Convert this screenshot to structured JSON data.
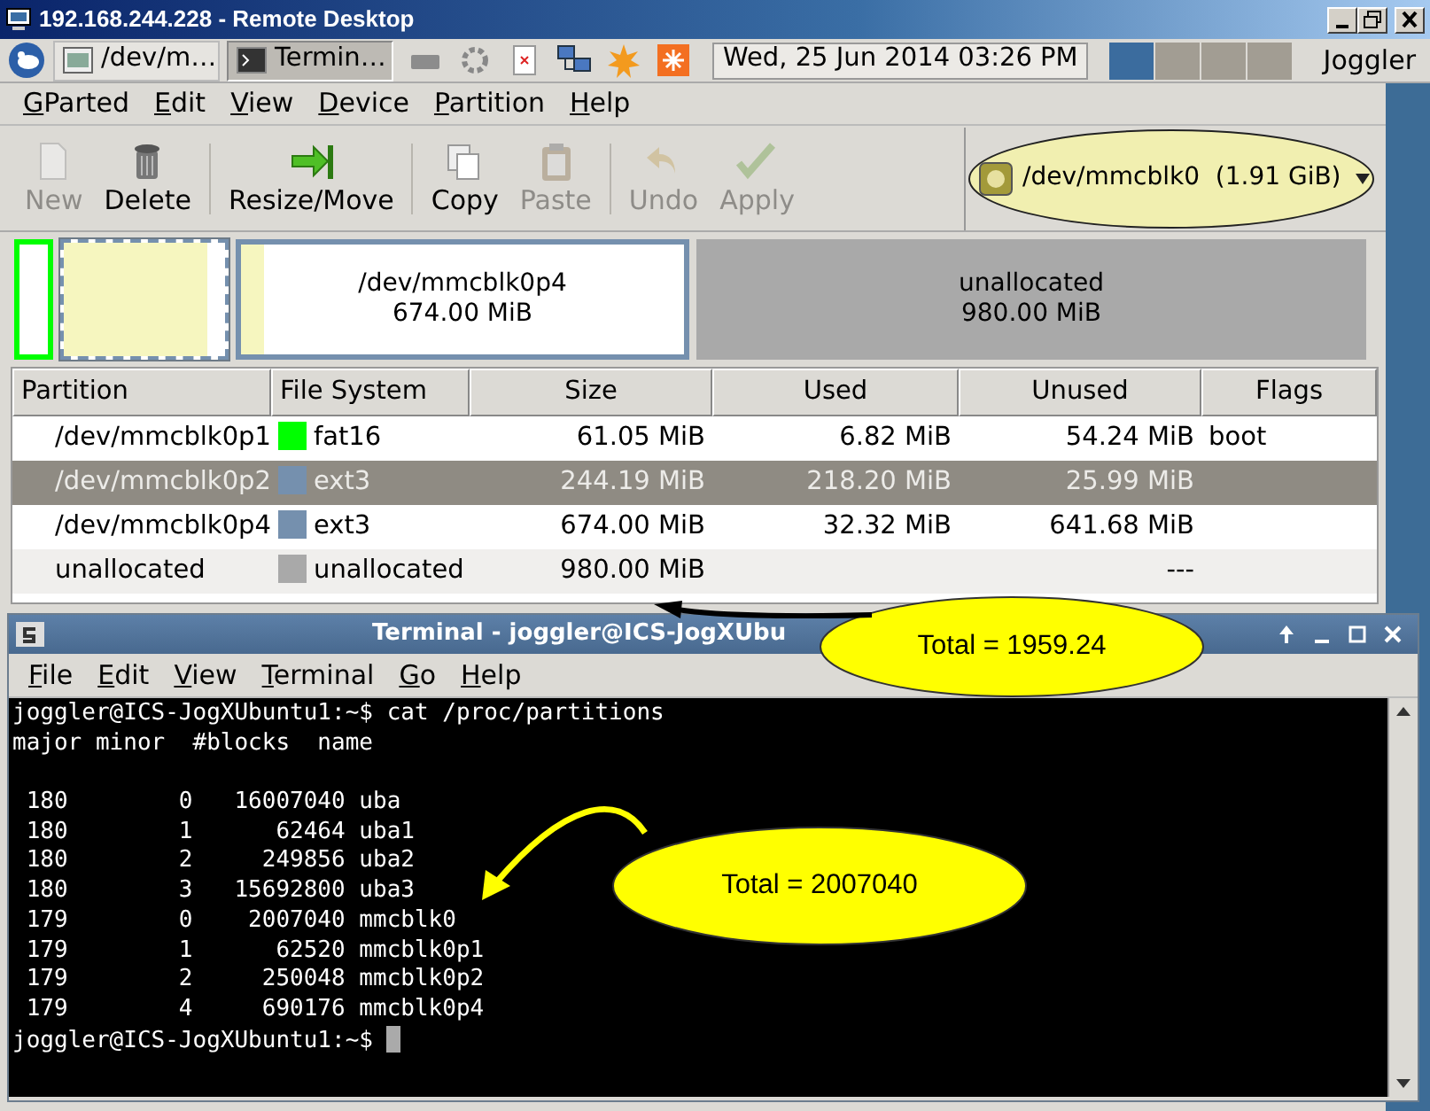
{
  "remote_window": {
    "title": "192.168.244.228 - Remote Desktop"
  },
  "taskbar": {
    "tasks": [
      {
        "label": "/dev/m…",
        "selected": false
      },
      {
        "label": "Termin…",
        "selected": true
      }
    ],
    "clock": "Wed, 25 Jun 2014 03:26 PM",
    "pager": [
      {
        "selected": true
      },
      {
        "selected": false
      },
      {
        "selected": false
      },
      {
        "selected": false
      }
    ],
    "user": "Joggler"
  },
  "gparted": {
    "menu": [
      "GParted",
      "Edit",
      "View",
      "Device",
      "Partition",
      "Help"
    ],
    "toolbar": [
      {
        "label": "New",
        "kind": "new",
        "disabled": true
      },
      {
        "label": "Delete",
        "kind": "delete",
        "disabled": false
      },
      {
        "label": "Resize/Move",
        "kind": "resize",
        "disabled": false
      },
      {
        "label": "Copy",
        "kind": "copy",
        "disabled": false
      },
      {
        "label": "Paste",
        "kind": "paste",
        "disabled": true
      },
      {
        "label": "Undo",
        "kind": "undo",
        "disabled": true
      },
      {
        "label": "Apply",
        "kind": "apply",
        "disabled": true
      }
    ],
    "device": "/dev/mmcblk0  (1.91 GiB)",
    "partition_map": [
      {
        "kind": "partition",
        "color": "#00ff00",
        "selected": false
      },
      {
        "kind": "partition",
        "color": "#7590ae",
        "level": 0.89,
        "selected": true
      },
      {
        "kind": "partition",
        "color": "#7590ae",
        "level": 0.05,
        "selected": false,
        "name": "/dev/mmcblk0p4",
        "size": "674.00 MiB"
      },
      {
        "kind": "unallocated",
        "color": "#a9a9a9",
        "selected": false,
        "name": "unallocated",
        "size": "980.00 MiB"
      }
    ],
    "table": {
      "columns": [
        "Partition",
        "File System",
        "Size",
        "Used",
        "Unused",
        "Flags"
      ],
      "rows": [
        {
          "partition": "/dev/mmcblk0p1",
          "color": "#00ff00",
          "file_system": "fat16",
          "size": "61.05 MiB",
          "used": "6.82 MiB",
          "unused": "54.24 MiB",
          "flags": "boot",
          "selected": false
        },
        {
          "partition": "/dev/mmcblk0p2",
          "color": "#7590ae",
          "file_system": "ext3",
          "size": "244.19 MiB",
          "used": "218.20 MiB",
          "unused": "25.99 MiB",
          "selected": true
        },
        {
          "partition": "/dev/mmcblk0p4",
          "color": "#7590ae",
          "file_system": "ext3",
          "size": "674.00 MiB",
          "used": "32.32 MiB",
          "unused": "641.68 MiB",
          "selected": false
        },
        {
          "partition": "unallocated",
          "color": "#a9a9a9",
          "file_system": "unallocated",
          "size": "980.00 MiB",
          "unused": "---",
          "selected": false
        }
      ]
    }
  },
  "terminal": {
    "title": "Terminal - joggler@ICS-JogXUbu",
    "menu": [
      "File",
      "Edit",
      "View",
      "Terminal",
      "Go",
      "Help"
    ],
    "lines": [
      {
        "kind": "command",
        "text": "joggler@ICS-JogXUbuntu1:~$ cat /proc/partitions"
      },
      {
        "kind": "output",
        "text": "major minor  #blocks  name",
        "gap_after": true
      },
      {
        "kind": "output",
        "text": " 180        0   16007040 uba"
      },
      {
        "kind": "output",
        "text": " 180        1      62464 uba1"
      },
      {
        "kind": "output",
        "text": " 180        2     249856 uba2"
      },
      {
        "kind": "output",
        "text": " 180        3   15692800 uba3"
      },
      {
        "kind": "output",
        "text": " 179        0    2007040 mmcblk0"
      },
      {
        "kind": "output",
        "text": " 179        1      62520 mmcblk0p1"
      },
      {
        "kind": "output",
        "text": " 179        2     250048 mmcblk0p2"
      },
      {
        "kind": "output",
        "text": " 179        4     690176 mmcblk0p4"
      },
      {
        "kind": "prompt",
        "text": "joggler@ICS-JogXUbuntu1:~$ "
      }
    ]
  },
  "annotations": [
    {
      "text": "Total = 1959.24"
    },
    {
      "text": "Total = 2007040"
    }
  ]
}
